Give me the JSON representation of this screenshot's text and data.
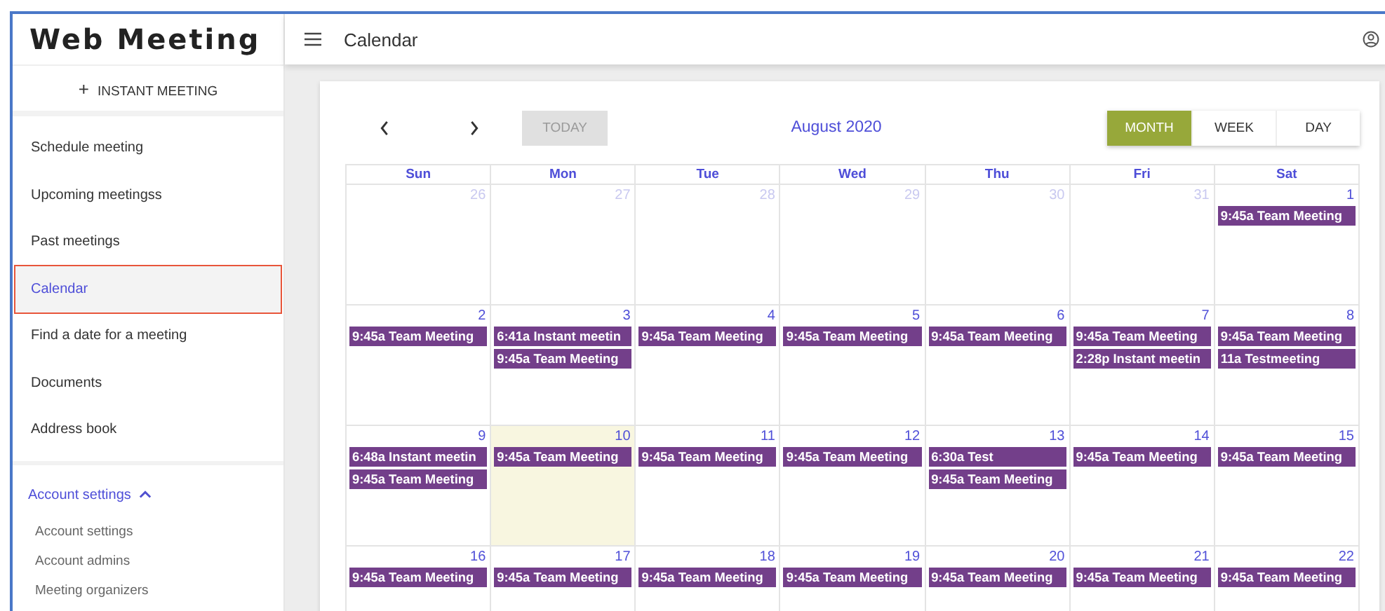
{
  "app_title": "Web Meeting",
  "page_title": "Calendar",
  "instant_button": {
    "icon": "+",
    "label": "INSTANT MEETING"
  },
  "sidebar": {
    "items": [
      {
        "label": "Schedule meeting",
        "selected": false
      },
      {
        "label": "Upcoming meetingss",
        "selected": false
      },
      {
        "label": "Past meetings",
        "selected": false
      },
      {
        "label": "Calendar",
        "selected": true
      },
      {
        "label": "Find a date for a meeting",
        "selected": false
      },
      {
        "label": "Documents",
        "selected": false
      },
      {
        "label": "Address book",
        "selected": false
      }
    ],
    "section": {
      "label": "Account settings",
      "expanded": true,
      "children": [
        "Account settings",
        "Account admins",
        "Meeting organizers"
      ]
    }
  },
  "calendar": {
    "today_label": "TODAY",
    "title": "August 2020",
    "views": [
      {
        "label": "MONTH",
        "selected": true
      },
      {
        "label": "WEEK",
        "selected": false
      },
      {
        "label": "DAY",
        "selected": false
      }
    ],
    "weekdays": [
      "Sun",
      "Mon",
      "Tue",
      "Wed",
      "Thu",
      "Fri",
      "Sat"
    ],
    "weeks": [
      [
        {
          "day": "26",
          "other_month": true,
          "today": false
        },
        {
          "day": "27",
          "other_month": true,
          "today": false
        },
        {
          "day": "28",
          "other_month": true,
          "today": false
        },
        {
          "day": "29",
          "other_month": true,
          "today": false
        },
        {
          "day": "30",
          "other_month": true,
          "today": false
        },
        {
          "day": "31",
          "other_month": true,
          "today": false
        },
        {
          "day": "1",
          "other_month": false,
          "today": false,
          "events": [
            "9:45a Team Meeting"
          ]
        }
      ],
      [
        {
          "day": "2",
          "other_month": false,
          "today": false,
          "events": [
            "9:45a Team Meeting"
          ]
        },
        {
          "day": "3",
          "other_month": false,
          "today": false,
          "events": [
            "6:41a Instant meetin",
            "9:45a Team Meeting"
          ]
        },
        {
          "day": "4",
          "other_month": false,
          "today": false,
          "events": [
            "9:45a Team Meeting"
          ]
        },
        {
          "day": "5",
          "other_month": false,
          "today": false,
          "events": [
            "9:45a Team Meeting"
          ]
        },
        {
          "day": "6",
          "other_month": false,
          "today": false,
          "events": [
            "9:45a Team Meeting"
          ]
        },
        {
          "day": "7",
          "other_month": false,
          "today": false,
          "events": [
            "9:45a Team Meeting",
            "2:28p Instant meetin"
          ]
        },
        {
          "day": "8",
          "other_month": false,
          "today": false,
          "events": [
            "9:45a Team Meeting",
            "11a Testmeeting"
          ]
        }
      ],
      [
        {
          "day": "9",
          "other_month": false,
          "today": false,
          "events": [
            "6:48a Instant meetin",
            "9:45a Team Meeting"
          ]
        },
        {
          "day": "10",
          "other_month": false,
          "today": true,
          "events": [
            "9:45a Team Meeting"
          ]
        },
        {
          "day": "11",
          "other_month": false,
          "today": false,
          "events": [
            "9:45a Team Meeting"
          ]
        },
        {
          "day": "12",
          "other_month": false,
          "today": false,
          "events": [
            "9:45a Team Meeting"
          ]
        },
        {
          "day": "13",
          "other_month": false,
          "today": false,
          "events": [
            "6:30a Test",
            "9:45a Team Meeting"
          ]
        },
        {
          "day": "14",
          "other_month": false,
          "today": false,
          "events": [
            "9:45a Team Meeting"
          ]
        },
        {
          "day": "15",
          "other_month": false,
          "today": false,
          "events": [
            "9:45a Team Meeting"
          ]
        }
      ],
      [
        {
          "day": "16",
          "other_month": false,
          "today": false,
          "events": [
            "9:45a Team Meeting"
          ]
        },
        {
          "day": "17",
          "other_month": false,
          "today": false,
          "events": [
            "9:45a Team Meeting"
          ]
        },
        {
          "day": "18",
          "other_month": false,
          "today": false,
          "events": [
            "9:45a Team Meeting"
          ]
        },
        {
          "day": "19",
          "other_month": false,
          "today": false,
          "events": [
            "9:45a Team Meeting"
          ]
        },
        {
          "day": "20",
          "other_month": false,
          "today": false,
          "events": [
            "9:45a Team Meeting"
          ]
        },
        {
          "day": "21",
          "other_month": false,
          "today": false,
          "events": [
            "9:45a Team Meeting"
          ]
        },
        {
          "day": "22",
          "other_month": false,
          "today": false,
          "events": [
            "9:45a Team Meeting"
          ]
        }
      ]
    ]
  }
}
